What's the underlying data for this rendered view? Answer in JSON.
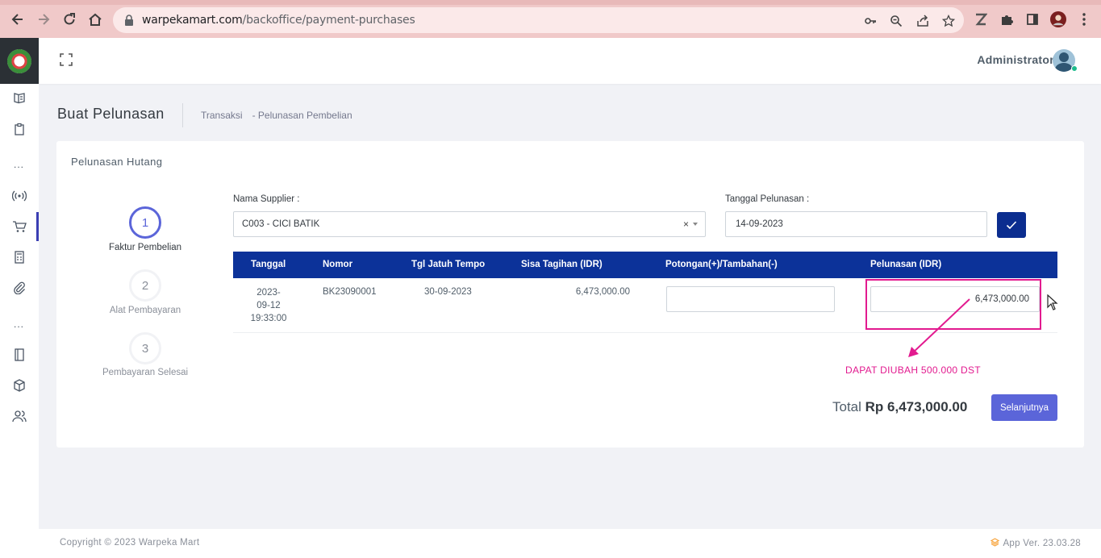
{
  "browser": {
    "url_host": "warpekamart.com",
    "url_path": "/backoffice/payment-purchases",
    "profile_color": "#c4302b"
  },
  "topbar": {
    "user_name": "Administrator"
  },
  "header": {
    "title": "Buat Pelunasan",
    "breadcrumb": [
      "Transaksi",
      "- Pelunasan Pembelian"
    ]
  },
  "card": {
    "title": "Pelunasan Hutang"
  },
  "stepper": [
    {
      "number": "1",
      "label": "Faktur Pembelian",
      "active": true
    },
    {
      "number": "2",
      "label": "Alat Pembayaran",
      "active": false
    },
    {
      "number": "3",
      "label": "Pembayaran Selesai",
      "active": false
    }
  ],
  "form": {
    "supplier_label": "Nama Supplier :",
    "supplier_value": "C003 - CICI BATIK",
    "supplier_clear": "×",
    "date_label": "Tanggal Pelunasan :",
    "date_value": "14-09-2023"
  },
  "table": {
    "headers": [
      "Tanggal",
      "Nomor",
      "Tgl Jatuh Tempo",
      "Sisa Tagihan (IDR)",
      "Potongan(+)/Tambahan(-)",
      "Pelunasan (IDR)"
    ],
    "rows": [
      {
        "date_line1": "2023-",
        "date_line2": "09-12",
        "date_line3": "19:33:00",
        "nomor": "BK23090001",
        "due": "30-09-2023",
        "sisa": "6,473,000.00",
        "potongan": "",
        "pelunasan": "6,473,000.00"
      }
    ]
  },
  "annotation": "DAPAT DIUBAH 500.000 DST",
  "summary": {
    "total_label": "Total",
    "total_value": "Rp 6,473,000.00",
    "next_label": "Selanjutnya"
  },
  "footer": {
    "copyright": "Copyright © 2023 Warpeka Mart",
    "version": "App Ver. 23.03.28"
  },
  "colors": {
    "primary": "#5b65d9",
    "table_header": "#0c3299",
    "annotation": "#e21a8f"
  }
}
